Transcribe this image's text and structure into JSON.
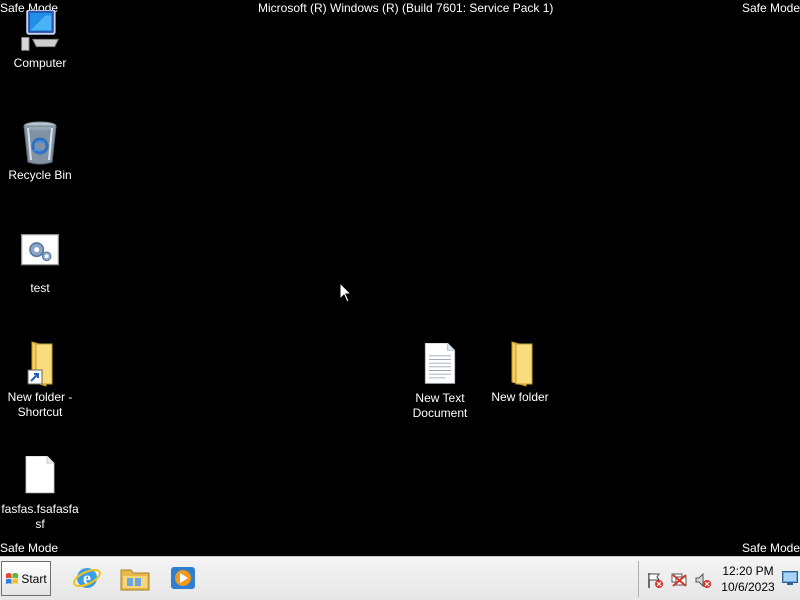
{
  "safe_mode": {
    "top_left": "Safe Mode",
    "top_right": "Safe Mode",
    "bottom_left": "Safe Mode",
    "bottom_right": "Safe Mode"
  },
  "title": "Microsoft (R) Windows (R) (Build 7601: Service Pack 1)",
  "desktop_icons": [
    {
      "label": "Computer",
      "icon": "computer-icon"
    },
    {
      "label": "Recycle Bin",
      "icon": "recycle-bin-icon"
    },
    {
      "label": "test",
      "icon": "settings-file-icon"
    },
    {
      "label": "New folder - Shortcut",
      "icon": "folder-shortcut-icon"
    },
    {
      "label": "fasfas.fsafasfasf",
      "icon": "blank-file-icon"
    },
    {
      "label": "New Text Document",
      "icon": "text-document-icon"
    },
    {
      "label": "New folder",
      "icon": "folder-icon"
    }
  ],
  "taskbar": {
    "start_label": "Start",
    "pinned": [
      {
        "name": "Internet Explorer",
        "icon": "internet-explorer-icon"
      },
      {
        "name": "Windows Explorer",
        "icon": "file-explorer-icon"
      },
      {
        "name": "Windows Media Player",
        "icon": "media-player-icon"
      }
    ],
    "tray": {
      "icons": [
        "action-center-icon",
        "network-error-icon",
        "volume-muted-icon"
      ],
      "time": "12:20 PM",
      "date": "10/6/2023"
    }
  },
  "colors": {
    "desktop_background": "#000000",
    "taskbar_background": "#ececec",
    "text": "#ffffff"
  }
}
